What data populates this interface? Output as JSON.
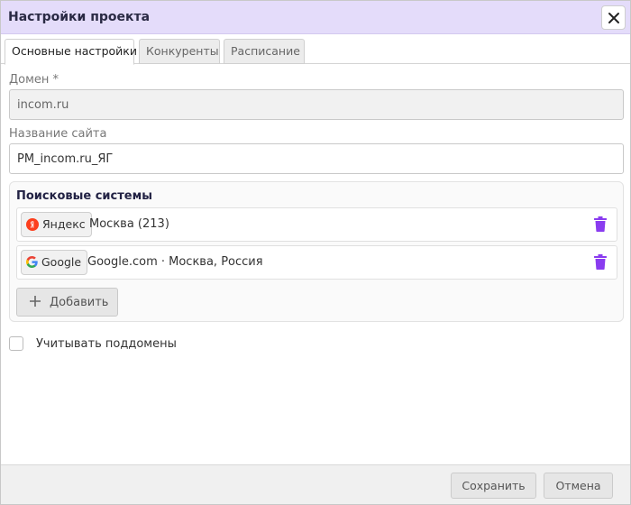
{
  "dialog": {
    "title": "Настройки проекта"
  },
  "tabs": [
    {
      "label": "Основные настройки",
      "active": true
    },
    {
      "label": "Конкуренты",
      "active": false
    },
    {
      "label": "Расписание",
      "active": false
    }
  ],
  "form": {
    "domain_label": "Домен *",
    "domain_value": "incom.ru",
    "site_name_label": "Название сайта",
    "site_name_value": "PM_incom.ru_ЯГ"
  },
  "search_engines": {
    "title": "Поисковые системы",
    "items": [
      {
        "engine": "Яндекс",
        "icon": "yandex-logo-icon",
        "region": "Москва (213)"
      },
      {
        "engine": "Google",
        "icon": "google-logo-icon",
        "region": "Google.com · Москва, Россия"
      }
    ],
    "add_label": "Добавить"
  },
  "subdomains": {
    "label": "Учитывать поддомены",
    "checked": false
  },
  "footer": {
    "save_label": "Сохранить",
    "cancel_label": "Отмена"
  },
  "colors": {
    "titlebar_bg": "#e4dcfa",
    "trash_icon": "#8a3cf0",
    "yandex_red": "#fc3f1d"
  }
}
